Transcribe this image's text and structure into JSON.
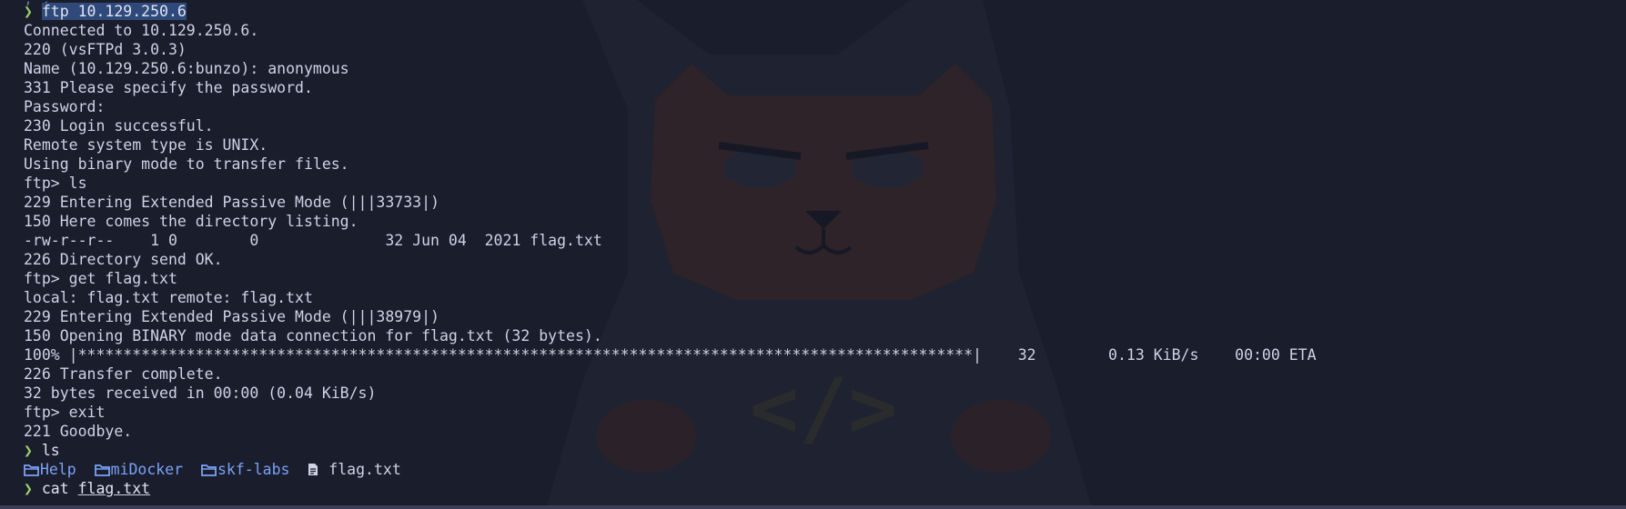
{
  "terminal": {
    "top_fragment": ", ,",
    "lines": [
      {
        "kind": "prompt",
        "symbol": "❯",
        "command": "ftp 10.129.250.6",
        "selected": true
      },
      {
        "kind": "out",
        "text": "Connected to 10.129.250.6."
      },
      {
        "kind": "out",
        "text": "220 (vsFTPd 3.0.3)"
      },
      {
        "kind": "out",
        "text": "Name (10.129.250.6:bunzo): anonymous"
      },
      {
        "kind": "out",
        "text": "331 Please specify the password."
      },
      {
        "kind": "out",
        "text": "Password:"
      },
      {
        "kind": "out",
        "text": "230 Login successful."
      },
      {
        "kind": "out",
        "text": "Remote system type is UNIX."
      },
      {
        "kind": "out",
        "text": "Using binary mode to transfer files."
      },
      {
        "kind": "out",
        "text": "ftp> ls"
      },
      {
        "kind": "out",
        "text": "229 Entering Extended Passive Mode (|||33733|)"
      },
      {
        "kind": "out",
        "text": "150 Here comes the directory listing."
      },
      {
        "kind": "out",
        "text": "-rw-r--r--    1 0        0              32 Jun 04  2021 flag.txt"
      },
      {
        "kind": "out",
        "text": "226 Directory send OK."
      },
      {
        "kind": "out",
        "text": "ftp> get flag.txt"
      },
      {
        "kind": "out",
        "text": "local: flag.txt remote: flag.txt"
      },
      {
        "kind": "out",
        "text": "229 Entering Extended Passive Mode (|||38979|)"
      },
      {
        "kind": "out",
        "text": "150 Opening BINARY mode data connection for flag.txt (32 bytes)."
      },
      {
        "kind": "out",
        "text": "100% |***************************************************************************************************|    32        0.13 KiB/s    00:00 ETA"
      },
      {
        "kind": "out",
        "text": "226 Transfer complete."
      },
      {
        "kind": "out",
        "text": "32 bytes received in 00:00 (0.04 KiB/s)"
      },
      {
        "kind": "out",
        "text": "ftp> exit"
      },
      {
        "kind": "out",
        "text": "221 Goodbye."
      },
      {
        "kind": "prompt",
        "symbol": "❯",
        "command": "ls"
      },
      {
        "kind": "ls",
        "items": [
          {
            "type": "folder",
            "name": "Help",
            "icon": "folder-icon"
          },
          {
            "type": "folder",
            "name": "miDocker",
            "icon": "folder-icon"
          },
          {
            "type": "folder",
            "name": "skf-labs",
            "icon": "folder-icon"
          },
          {
            "type": "file",
            "name": "flag.txt",
            "icon": "file-icon"
          }
        ]
      },
      {
        "kind": "prompt",
        "symbol": "❯",
        "command": "cat",
        "arg": "flag.txt"
      }
    ]
  },
  "colors": {
    "background": "#1a1d2b",
    "prompt": "#9ece6a",
    "directory": "#7aa2f7",
    "text": "#cdd2e6",
    "selection": "#2f4a7a"
  }
}
